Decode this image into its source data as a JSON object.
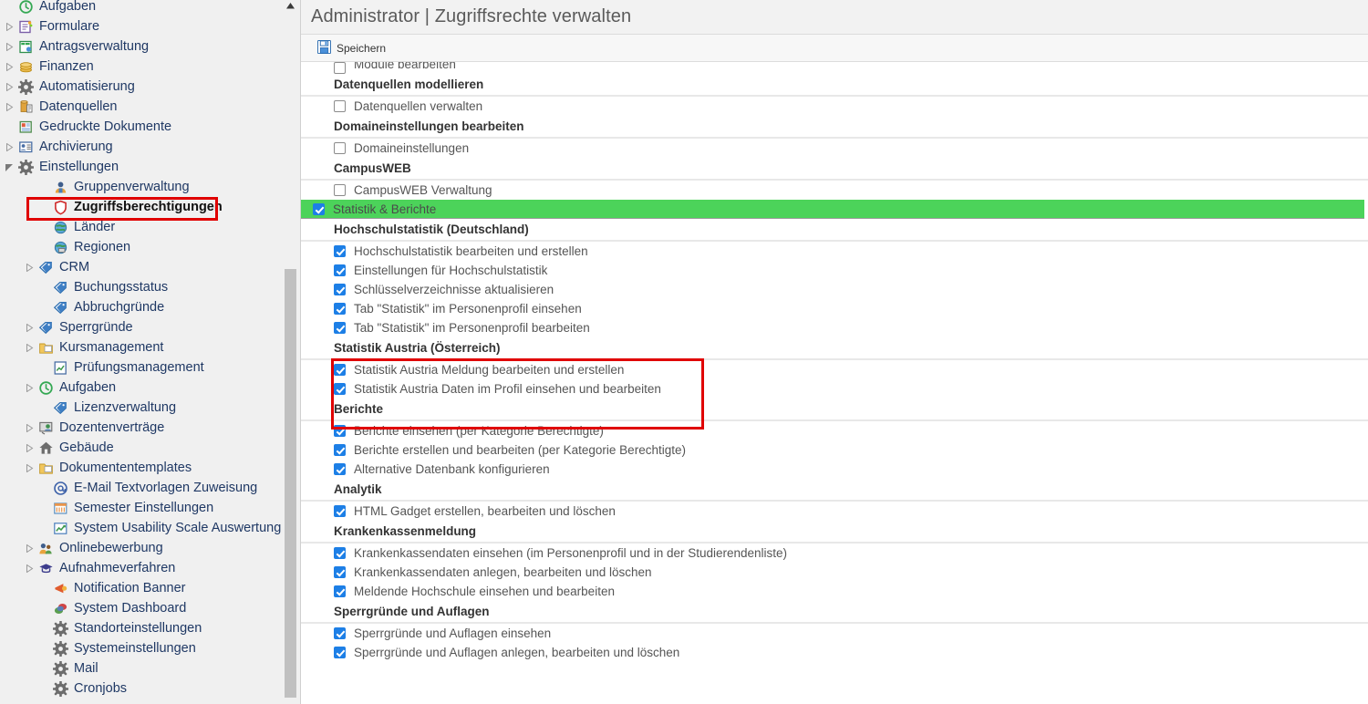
{
  "window": {
    "title": "Administrator | Zugriffsrechte verwalten"
  },
  "toolbar": {
    "save_label": "Speichern",
    "save_icon": "save-floppy-icon"
  },
  "colors": {
    "module_selected_green": "#4cd35a",
    "checkbox_blue": "#1d7fe6",
    "annotation_red": "#e00000",
    "sidebar_bg": "#f0f0f0",
    "title_text": "#5a5a5a",
    "tree_text": "#1f3864"
  },
  "sidebar": {
    "scrollbar": {
      "orientation": "vertical",
      "arrow_icon": "caret-up-icon"
    },
    "items": [
      {
        "label": "Aufgaben",
        "icon": "clock-history-icon",
        "level": 1,
        "arrow": false,
        "selected": false
      },
      {
        "label": "Formulare",
        "icon": "form-icon",
        "level": 1,
        "arrow": true,
        "selected": false
      },
      {
        "label": "Antragsverwaltung",
        "icon": "application-icon",
        "level": 1,
        "arrow": true,
        "selected": false
      },
      {
        "label": "Finanzen",
        "icon": "coins-icon",
        "level": 1,
        "arrow": true,
        "selected": false
      },
      {
        "label": "Automatisierung",
        "icon": "gear-icon",
        "level": 1,
        "arrow": true,
        "selected": false
      },
      {
        "label": "Datenquellen",
        "icon": "database-icon",
        "level": 1,
        "arrow": true,
        "selected": false
      },
      {
        "label": "Gedruckte Dokumente",
        "icon": "document-icon",
        "level": 1,
        "arrow": false,
        "selected": false
      },
      {
        "label": "Archivierung",
        "icon": "archive-card-icon",
        "level": 1,
        "arrow": true,
        "selected": false
      },
      {
        "label": "Einstellungen",
        "icon": "gear-icon",
        "level": 1,
        "arrow": true,
        "expanded": true,
        "selected": false
      },
      {
        "label": "Gruppenverwaltung",
        "icon": "user-group-icon",
        "level": 2,
        "arrow": false,
        "selected": false
      },
      {
        "label": "Zugriffsberechtigungen",
        "icon": "shield-icon",
        "level": 2,
        "arrow": false,
        "selected": true
      },
      {
        "label": "Länder",
        "icon": "globe-icon",
        "level": 2,
        "arrow": false,
        "selected": false
      },
      {
        "label": "Regionen",
        "icon": "globe-region-icon",
        "level": 2,
        "arrow": false,
        "selected": false
      },
      {
        "label": "CRM",
        "icon": "tag-icon",
        "level": 2,
        "arrow": true,
        "selected": false
      },
      {
        "label": "Buchungsstatus",
        "icon": "tag-icon",
        "level": 2,
        "arrow": false,
        "selected": false
      },
      {
        "label": "Abbruchgründe",
        "icon": "tag-icon",
        "level": 2,
        "arrow": false,
        "selected": false
      },
      {
        "label": "Sperrgründe",
        "icon": "tag-icon",
        "level": 2,
        "arrow": true,
        "selected": false
      },
      {
        "label": "Kursmanagement",
        "icon": "folder-icon",
        "level": 2,
        "arrow": true,
        "selected": false
      },
      {
        "label": "Prüfungsmanagement",
        "icon": "exam-icon",
        "level": 2,
        "arrow": false,
        "selected": false
      },
      {
        "label": "Aufgaben",
        "icon": "clock-history-icon",
        "level": 2,
        "arrow": true,
        "selected": false
      },
      {
        "label": "Lizenzverwaltung",
        "icon": "tag-icon",
        "level": 2,
        "arrow": false,
        "selected": false
      },
      {
        "label": "Dozentenverträge",
        "icon": "teacher-icon",
        "level": 2,
        "arrow": true,
        "selected": false
      },
      {
        "label": "Gebäude",
        "icon": "house-icon",
        "level": 2,
        "arrow": true,
        "selected": false
      },
      {
        "label": "Dokumententemplates",
        "icon": "folder-icon",
        "level": 2,
        "arrow": true,
        "selected": false
      },
      {
        "label": "E-Mail Textvorlagen Zuweisung",
        "icon": "at-icon",
        "level": 2,
        "arrow": false,
        "selected": false
      },
      {
        "label": "Semester Einstellungen",
        "icon": "calendar-icon",
        "level": 2,
        "arrow": false,
        "selected": false
      },
      {
        "label": "System Usability Scale Auswertung",
        "icon": "chart-line-icon",
        "level": 2,
        "arrow": false,
        "selected": false
      },
      {
        "label": "Onlinebewerbung",
        "icon": "people-icon",
        "level": 2,
        "arrow": true,
        "selected": false
      },
      {
        "label": "Aufnahmeverfahren",
        "icon": "graduation-cap-icon",
        "level": 2,
        "arrow": true,
        "selected": false
      },
      {
        "label": "Notification Banner",
        "icon": "megaphone-icon",
        "level": 2,
        "arrow": false,
        "selected": false
      },
      {
        "label": "System Dashboard",
        "icon": "dashboard-icon",
        "level": 2,
        "arrow": false,
        "selected": false
      },
      {
        "label": "Standorteinstellungen",
        "icon": "gear-icon",
        "level": 2,
        "arrow": false,
        "selected": false
      },
      {
        "label": "Systemeinstellungen",
        "icon": "gear-icon",
        "level": 2,
        "arrow": false,
        "selected": false
      },
      {
        "label": "Mail",
        "icon": "gear-icon",
        "level": 2,
        "arrow": false,
        "selected": false
      },
      {
        "label": "Cronjobs",
        "icon": "gear-icon",
        "level": 2,
        "arrow": false,
        "selected": false
      }
    ]
  },
  "permissions": {
    "cut_off_top_row": {
      "label": "Module bearbeiten",
      "checked": false
    },
    "blocks": [
      {
        "type": "group",
        "header": "Datenquellen modellieren",
        "options": [
          {
            "label": "Datenquellen verwalten",
            "checked": false
          }
        ]
      },
      {
        "type": "group",
        "header": "Domaineinstellungen bearbeiten",
        "options": [
          {
            "label": "Domaineinstellungen",
            "checked": false
          }
        ]
      },
      {
        "type": "group",
        "header": "CampusWEB",
        "options": [
          {
            "label": "CampusWEB Verwaltung",
            "checked": false
          }
        ]
      },
      {
        "type": "module",
        "label": "Statistik & Berichte",
        "checked": true,
        "highlighted": true
      },
      {
        "type": "group",
        "header": "Hochschulstatistik (Deutschland)",
        "options": [
          {
            "label": "Hochschulstatistik bearbeiten und erstellen",
            "checked": true
          },
          {
            "label": "Einstellungen für Hochschulstatistik",
            "checked": true
          },
          {
            "label": "Schlüsselverzeichnisse aktualisieren",
            "checked": true
          },
          {
            "label": "Tab \"Statistik\" im Personenprofil einsehen",
            "checked": true
          },
          {
            "label": "Tab \"Statistik\" im Personenprofil bearbeiten",
            "checked": true
          }
        ]
      },
      {
        "type": "group",
        "header": "Statistik Austria (Österreich)",
        "annotated": true,
        "options": [
          {
            "label": "Statistik Austria Meldung bearbeiten und erstellen",
            "checked": true
          },
          {
            "label": "Statistik Austria Daten im Profil einsehen und bearbeiten",
            "checked": true
          }
        ]
      },
      {
        "type": "group",
        "header": "Berichte",
        "options": [
          {
            "label": "Berichte einsehen (per Kategorie Berechtigte)",
            "checked": true
          },
          {
            "label": "Berichte erstellen und bearbeiten (per Kategorie Berechtigte)",
            "checked": true
          },
          {
            "label": "Alternative Datenbank konfigurieren",
            "checked": true
          }
        ]
      },
      {
        "type": "group",
        "header": "Analytik",
        "options": [
          {
            "label": "HTML Gadget erstellen, bearbeiten und löschen",
            "checked": true
          }
        ]
      },
      {
        "type": "group",
        "header": "Krankenkassenmeldung",
        "options": [
          {
            "label": "Krankenkassendaten einsehen (im Personenprofil und in der Studierendenliste)",
            "checked": true
          },
          {
            "label": "Krankenkassendaten anlegen, bearbeiten und löschen",
            "checked": true
          },
          {
            "label": "Meldende Hochschule einsehen und bearbeiten",
            "checked": true
          }
        ]
      },
      {
        "type": "group",
        "header": "Sperrgründe und Auflagen",
        "options": [
          {
            "label": "Sperrgründe und Auflagen einsehen",
            "checked": true
          },
          {
            "label": "Sperrgründe und Auflagen anlegen, bearbeiten und löschen",
            "checked": true
          }
        ]
      }
    ]
  }
}
